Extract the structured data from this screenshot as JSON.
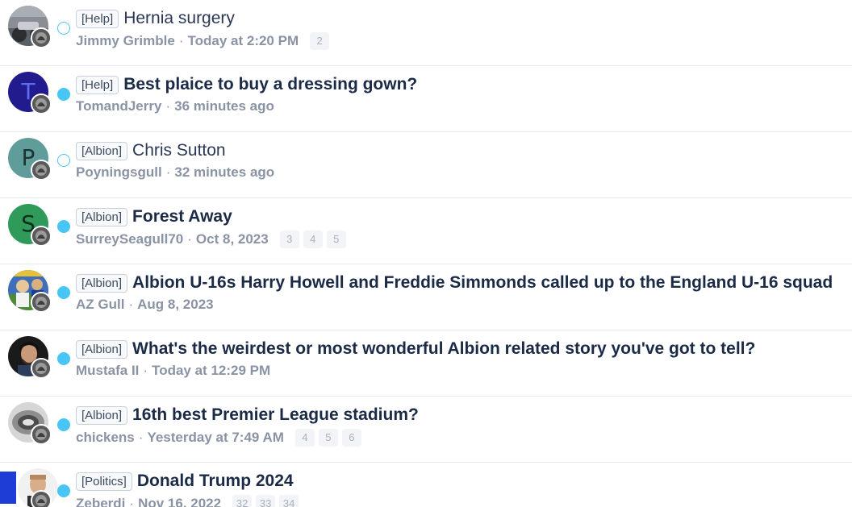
{
  "threads": [
    {
      "prefix": "[Help]",
      "title": "Hernia surgery",
      "author": "Jimmy Grimble",
      "date": "Today at 2:20 PM",
      "pages": [
        "2"
      ],
      "unread": false,
      "avatar": {
        "type": "photo",
        "icon": "avatar-photo-motorbike"
      }
    },
    {
      "prefix": "[Help]",
      "title": "Best plaice to buy a dressing gown?",
      "author": "TomandJerry",
      "date": "36 minutes ago",
      "pages": [],
      "unread": true,
      "avatar": {
        "type": "letter",
        "letter": "T",
        "bg": "#221b8e",
        "fg": "#5f6cf0"
      }
    },
    {
      "prefix": "[Albion]",
      "title": "Chris Sutton",
      "author": "Poyningsgull",
      "date": "32 minutes ago",
      "pages": [],
      "unread": false,
      "avatar": {
        "type": "letter",
        "letter": "P",
        "bg": "#5f9c9a",
        "fg": "#1c3534"
      }
    },
    {
      "prefix": "[Albion]",
      "title": "Forest Away",
      "author": "SurreySeagull70",
      "date": "Oct 8, 2023",
      "pages": [
        "3",
        "4",
        "5"
      ],
      "unread": true,
      "avatar": {
        "type": "letter",
        "letter": "S",
        "bg": "#2f9a5a",
        "fg": "#0e2e1a"
      }
    },
    {
      "prefix": "[Albion]",
      "title": "Albion U-16s Harry Howell and Freddie Simmonds called up to the England U-16 squad",
      "author": "AZ Gull",
      "date": "Aug 8, 2023",
      "pages": [],
      "unread": true,
      "avatar": {
        "type": "photo",
        "icon": "avatar-photo-football"
      }
    },
    {
      "prefix": "[Albion]",
      "title": "What's the weirdest or most wonderful Albion related story you've got to tell?",
      "author": "Mustafa II",
      "date": "Today at 12:29 PM",
      "pages": [],
      "unread": true,
      "avatar": {
        "type": "photo",
        "icon": "avatar-photo-man"
      }
    },
    {
      "prefix": "[Albion]",
      "title": "16th best Premier League stadium?",
      "author": "chickens",
      "date": "Yesterday at 7:49 AM",
      "pages": [
        "4",
        "5",
        "6"
      ],
      "unread": true,
      "avatar": {
        "type": "photo",
        "icon": "avatar-photo-stadium"
      }
    },
    {
      "prefix": "[Politics]",
      "title": "Donald Trump 2024",
      "author": "Zeberdi",
      "date": "Nov 16, 2022",
      "pages": [
        "32",
        "33",
        "34"
      ],
      "unread": true,
      "avatar": {
        "type": "photo",
        "icon": "avatar-photo-portrait"
      }
    }
  ],
  "colors": {
    "unread_dot": "#47c6f5",
    "title": "#1b2a47",
    "meta": "#8a93a4"
  }
}
